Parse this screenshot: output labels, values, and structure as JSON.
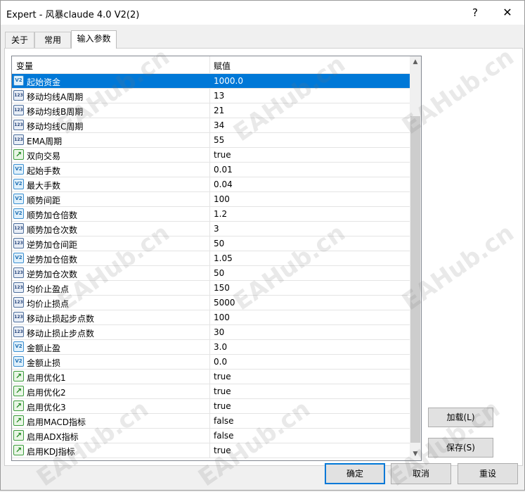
{
  "window": {
    "title": "Expert - 风暴claude 4.0 V2(2)",
    "help_label": "?",
    "close_label": "✕"
  },
  "tabs": [
    {
      "label": "关于"
    },
    {
      "label": "常用"
    },
    {
      "label": "输入参数"
    }
  ],
  "table": {
    "headers": {
      "variable": "变量",
      "value": "赋值"
    },
    "rows": [
      {
        "icon": "v2",
        "name": "起始资金",
        "value": "1000.0",
        "selected": true
      },
      {
        "icon": "n123",
        "name": "移动均线A周期",
        "value": "13"
      },
      {
        "icon": "n123",
        "name": "移动均线B周期",
        "value": "21"
      },
      {
        "icon": "n123",
        "name": "移动均线C周期",
        "value": "34"
      },
      {
        "icon": "n123",
        "name": "EMA周期",
        "value": "55"
      },
      {
        "icon": "bool",
        "name": "双向交易",
        "value": "true"
      },
      {
        "icon": "v2",
        "name": "起始手数",
        "value": "0.01"
      },
      {
        "icon": "v2",
        "name": "最大手数",
        "value": "0.04"
      },
      {
        "icon": "v2",
        "name": "顺势间距",
        "value": "100"
      },
      {
        "icon": "v2",
        "name": "顺势加仓倍数",
        "value": "1.2"
      },
      {
        "icon": "n123",
        "name": "顺势加仓次数",
        "value": "3"
      },
      {
        "icon": "n123",
        "name": "逆势加仓间距",
        "value": "50"
      },
      {
        "icon": "v2",
        "name": "逆势加仓倍数",
        "value": "1.05"
      },
      {
        "icon": "n123",
        "name": "逆势加仓次数",
        "value": "50"
      },
      {
        "icon": "n123",
        "name": "均价止盈点",
        "value": "150"
      },
      {
        "icon": "n123",
        "name": "均价止损点",
        "value": "5000"
      },
      {
        "icon": "n123",
        "name": "移动止损起步点数",
        "value": "100"
      },
      {
        "icon": "n123",
        "name": "移动止损止步点数",
        "value": "30"
      },
      {
        "icon": "v2",
        "name": "金额止盈",
        "value": "3.0"
      },
      {
        "icon": "v2",
        "name": "金额止损",
        "value": "0.0"
      },
      {
        "icon": "bool",
        "name": "启用优化1",
        "value": "true"
      },
      {
        "icon": "bool",
        "name": "启用优化2",
        "value": "true"
      },
      {
        "icon": "bool",
        "name": "启用优化3",
        "value": "true"
      },
      {
        "icon": "bool",
        "name": "启用MACD指标",
        "value": "false"
      },
      {
        "icon": "bool",
        "name": "启用ADX指标",
        "value": "false"
      },
      {
        "icon": "bool",
        "name": "启用KDJ指标",
        "value": "true"
      }
    ]
  },
  "icons": {
    "v2": "V2",
    "n123": "123",
    "bool": "↗"
  },
  "scrollbar": {
    "up": "▲",
    "down": "▼"
  },
  "buttons": {
    "load": "加载(L)",
    "save": "保存(S)",
    "ok": "确定",
    "cancel": "取消",
    "reset": "重设"
  },
  "watermark": "EAHub.cn",
  "colors": {
    "selection": "#0078d7",
    "ok_border": "#0078d7"
  }
}
